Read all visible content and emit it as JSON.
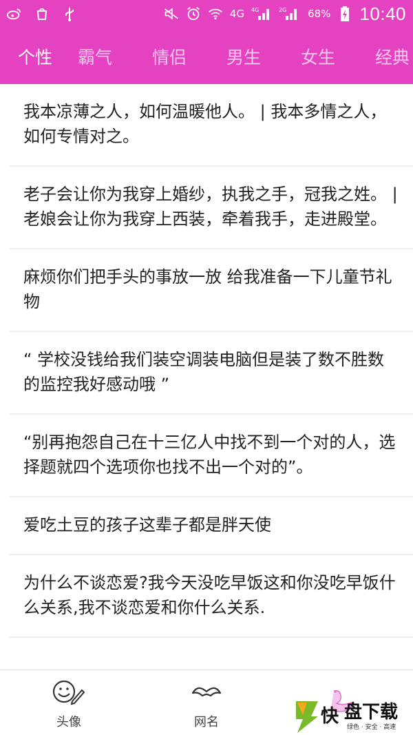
{
  "status_bar": {
    "network_4g_1": "4G",
    "network_4g_2": "4G",
    "network_2g": "2G",
    "battery": "68%",
    "time": "10:40"
  },
  "tabs": [
    {
      "label": "个性",
      "active": true
    },
    {
      "label": "霸气",
      "active": false
    },
    {
      "label": "情侣",
      "active": false
    },
    {
      "label": "男生",
      "active": false
    },
    {
      "label": "女生",
      "active": false
    },
    {
      "label": "经典",
      "active": false
    }
  ],
  "items": [
    {
      "text": "我本凉薄之人，如何温暖他人。    |  我本多情之人，如何专情对之。"
    },
    {
      "text": "老子会让你为我穿上婚纱，执我之手，冠我之姓。   |  老娘会让你为我穿上西装，牵着我手，走进殿堂。"
    },
    {
      "text": "麻烦你们把手头的事放一放   给我准备一下儿童节礼物"
    },
    {
      "text": "“ 学校没钱给我们装空调装电脑但是装了数不胜数的监控我好感动哦 ”"
    },
    {
      "text": "“别再抱怨自己在十三亿人中找不到一个对的人，选择题就四个选项你也找不出一个对的”。"
    },
    {
      "text": "爱吃土豆的孩子这辈子都是胖天使"
    },
    {
      "text": "为什么不谈恋爱?我今天没吃早饭这和你没吃早饭什么关系,我不谈恋爱和你什么关系."
    }
  ],
  "bottom_nav": {
    "avatar_label": "头像",
    "nickname_label": "网名"
  },
  "watermark": {
    "char": "快",
    "brand": "盘下载",
    "slogan": "绿色 · 安全 · 高速"
  },
  "colors": {
    "accent": "#e542c2",
    "tab_inactive": "#f6c7ec"
  },
  "icons": {
    "weibo": "weibo-icon",
    "bag": "shopping-bag-icon",
    "usb": "usb-icon",
    "mute": "mute-icon",
    "alarm": "alarm-icon",
    "wifi": "wifi-icon",
    "signal": "signal-icon",
    "battery": "battery-charging-icon",
    "avatar_nav": "smiley-pen-icon",
    "nickname_nav": "mustache-icon"
  }
}
